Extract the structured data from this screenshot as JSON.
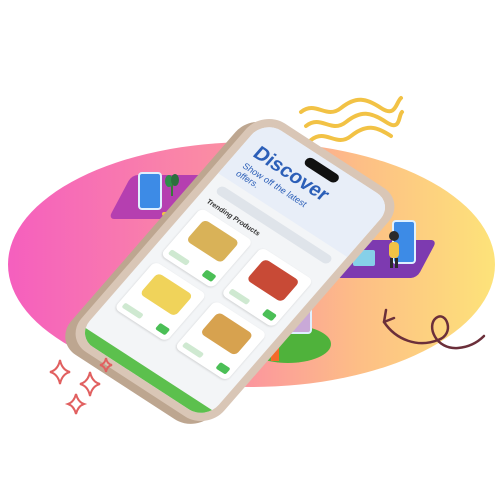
{
  "colors": {
    "blob_left": "#f55fbe",
    "blob_mid": "#fb8fa2",
    "blob_right": "#fde379",
    "accent_blue": "#2c5fb8",
    "green": "#4fb23b",
    "purple": "#b53fb0",
    "violet": "#7d3ab0",
    "wave_yellow": "#f2c245",
    "doodle_red": "#e16060",
    "curl_dark": "#6b2f3a"
  },
  "icons": {
    "waves": "wavy-lines-icon",
    "sparkles": "sparkle-icon",
    "curl": "loop-arrow-icon"
  },
  "app": {
    "title": "Discover",
    "subtitle": "Show off the latest offers.",
    "section": "Trending Products"
  },
  "products": [
    {
      "name": "",
      "color": "#d9b258"
    },
    {
      "name": "",
      "color": "#c84a36"
    },
    {
      "name": "",
      "color": "#f0d35a"
    },
    {
      "name": "",
      "color": "#d7a24f"
    }
  ]
}
